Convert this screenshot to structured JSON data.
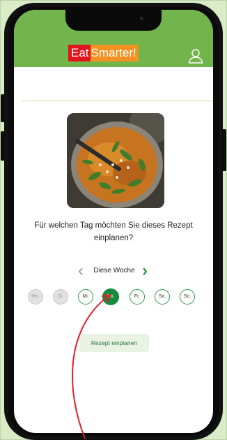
{
  "app": {
    "logo_part1": "Eat",
    "logo_part2": "Smarter!",
    "brand_red": "#e3141b",
    "brand_orange": "#f39222",
    "header_color": "#73b54d",
    "user_icon": "user-icon"
  },
  "dialog": {
    "question": "Für welchen Tag möchten Sie dieses Rezept einplanen?",
    "week_label": "Diese Woche",
    "prev_icon": "chevron-left-icon",
    "next_icon": "chevron-right-icon",
    "accent_color": "#178a3e",
    "days": [
      {
        "label": "Mo.",
        "state": "disabled"
      },
      {
        "label": "Di.",
        "state": "disabled"
      },
      {
        "label": "Mi.",
        "state": "available"
      },
      {
        "label": "Do.",
        "state": "selected"
      },
      {
        "label": "Fr.",
        "state": "available"
      },
      {
        "label": "Sa.",
        "state": "available"
      },
      {
        "label": "So.",
        "state": "available"
      }
    ],
    "plan_button": "Rezept einplanen"
  }
}
